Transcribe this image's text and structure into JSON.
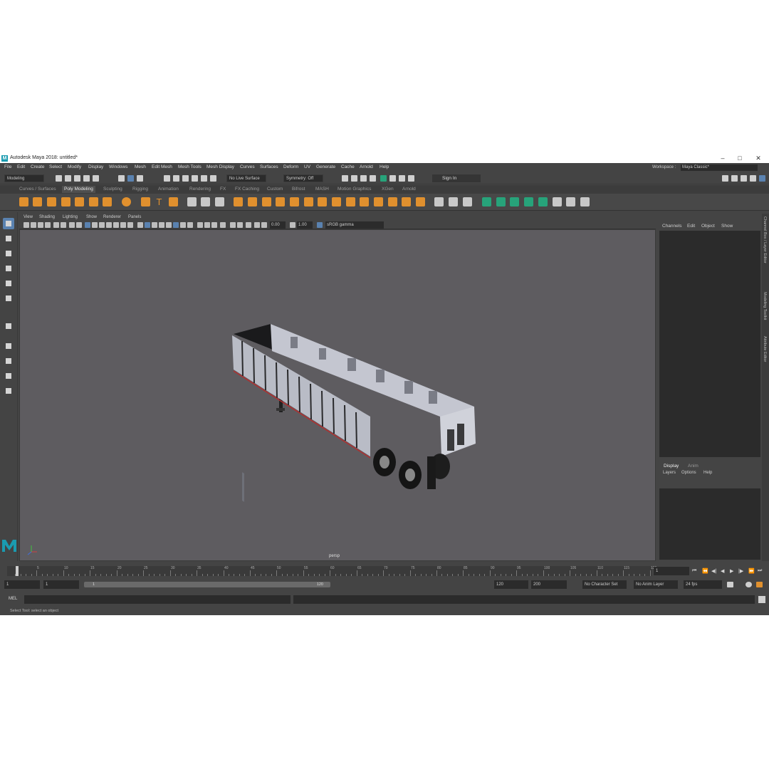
{
  "window": {
    "title": "Autodesk Maya 2018: untitled*",
    "logo_letter": "M",
    "minimize": "–",
    "maximize": "□",
    "close": "✕"
  },
  "menu": [
    "File",
    "Edit",
    "Create",
    "Select",
    "Modify",
    "Display",
    "Windows",
    "Mesh",
    "Edit Mesh",
    "Mesh Tools",
    "Mesh Display",
    "Curves",
    "Surfaces",
    "Deform",
    "UV",
    "Generate",
    "Cache",
    "Arnold",
    "Help"
  ],
  "workspace": {
    "label": "Workspace :",
    "value": "Maya Classic*"
  },
  "status": {
    "menuset": "Modeling",
    "live_surface": "No Live Surface",
    "symmetry": "Symmetry: Off",
    "signin": "Sign In"
  },
  "shelf_tabs": [
    "Curves / Surfaces",
    "Poly Modeling",
    "Sculpting",
    "Rigging",
    "Animation",
    "Rendering",
    "FX",
    "FX Caching",
    "Custom",
    "Bifrost",
    "MASH",
    "Motion Graphics",
    "XGen",
    "Arnold"
  ],
  "active_shelf": "Poly Modeling",
  "viewport": {
    "menu": [
      "View",
      "Shading",
      "Lighting",
      "Show",
      "Renderer",
      "Panels"
    ],
    "exposure": "0.00",
    "gamma": "1.00",
    "color_space": "sRGB gamma",
    "camera": "persp"
  },
  "channel_box": {
    "menu": [
      "Channels",
      "Edit",
      "Object",
      "Show"
    ],
    "tabs": [
      "Display",
      "Anim"
    ],
    "layer_menu": [
      "Layers",
      "Options",
      "Help"
    ],
    "side_tabs": [
      "Channel Box / Layer Editor",
      "Modeling Toolkit",
      "Attribute Editor"
    ]
  },
  "time_slider": {
    "ticks": [
      "5",
      "10",
      "15",
      "20",
      "25",
      "30",
      "35",
      "40",
      "45",
      "50",
      "55",
      "60",
      "65",
      "70",
      "75",
      "80",
      "85",
      "90",
      "95",
      "100",
      "105",
      "110",
      "115",
      "120"
    ],
    "current_frame": "1",
    "playhead_label": "1"
  },
  "range_slider": {
    "start": "1",
    "anim_start": "1",
    "range_start": "1",
    "range_end": "120",
    "playback_end": "120",
    "anim_end": "200",
    "character_set": "No Character Set",
    "anim_layer": "No Anim Layer",
    "fps": "24 fps"
  },
  "command": {
    "lang": "MEL",
    "help_text": "Select Tool: select an object"
  },
  "colors": {
    "bg": "#444444",
    "viewport": "#5e5c60",
    "accent_blue": "#5a82b0",
    "shelf_orange": "#e0902e",
    "shelf_teal": "#27a37a",
    "maya_teal": "#1a9bb0"
  }
}
